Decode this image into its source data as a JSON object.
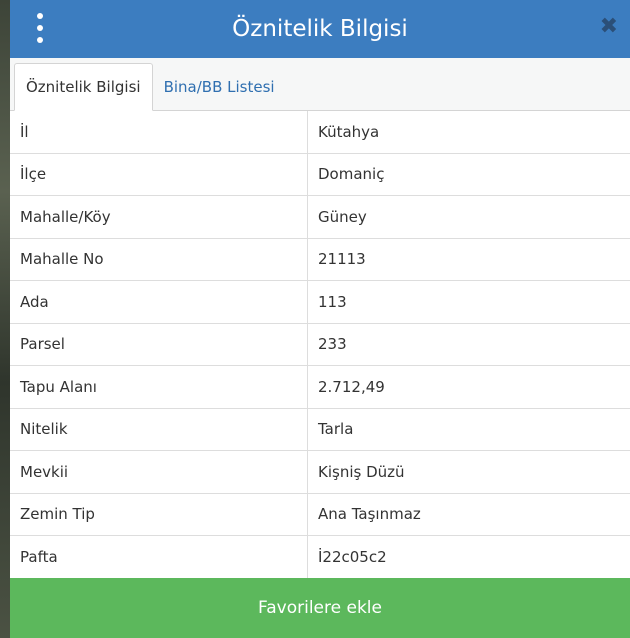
{
  "header": {
    "title": "Öznitelik Bilgisi",
    "menu_icon": "vertical-ellipsis",
    "close_icon": "close-x"
  },
  "tabs": [
    {
      "label": "Öznitelik Bilgisi",
      "active": true
    },
    {
      "label": "Bina/BB Listesi",
      "active": false
    }
  ],
  "attributes": [
    {
      "label": "İl",
      "value": "Kütahya"
    },
    {
      "label": "İlçe",
      "value": "Domaniç"
    },
    {
      "label": "Mahalle/Köy",
      "value": "Güney"
    },
    {
      "label": "Mahalle No",
      "value": "21113"
    },
    {
      "label": "Ada",
      "value": "113"
    },
    {
      "label": "Parsel",
      "value": "233"
    },
    {
      "label": "Tapu Alanı",
      "value": "2.712,49"
    },
    {
      "label": "Nitelik",
      "value": "Tarla"
    },
    {
      "label": "Mevkii",
      "value": "Kişniş Düzü"
    },
    {
      "label": "Zemin Tip",
      "value": "Ana Taşınmaz"
    },
    {
      "label": "Pafta",
      "value": "İ22c05c2"
    }
  ],
  "footer": {
    "button_label": "Favorilere ekle"
  },
  "colors": {
    "header_bg": "#3c7dc0",
    "footer_bg": "#5cb85c",
    "tab_link": "#2f6fb0"
  }
}
